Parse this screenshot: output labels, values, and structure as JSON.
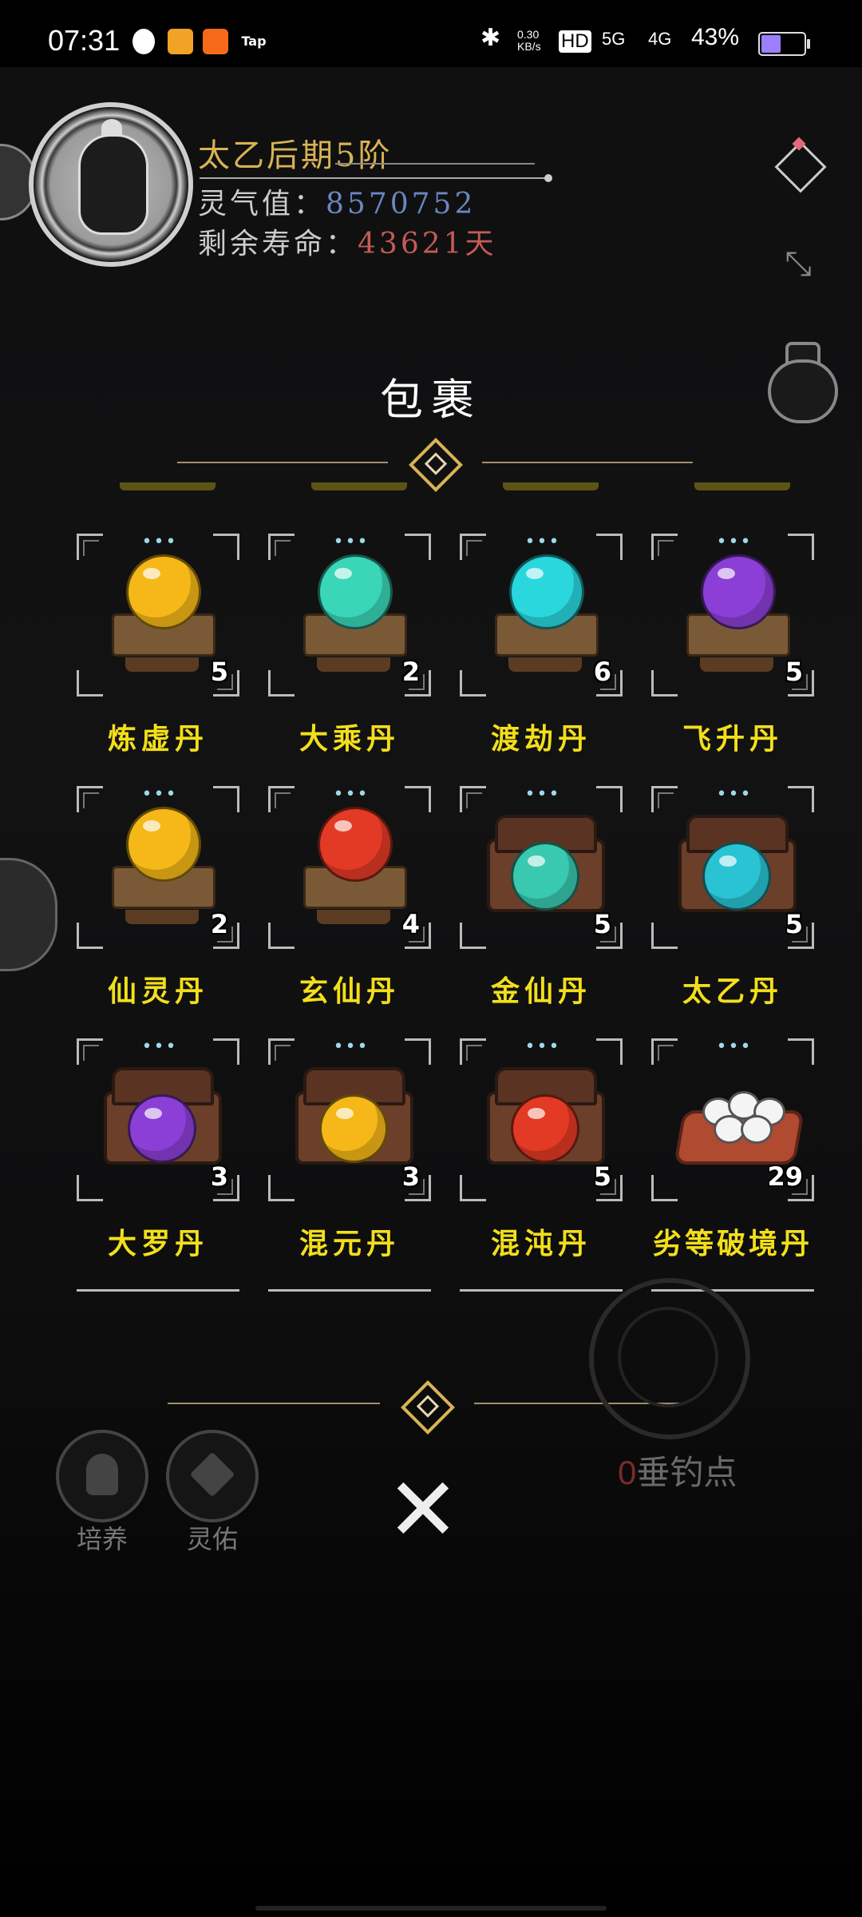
{
  "status_bar": {
    "time": "07:31",
    "speed": "0.30",
    "speed_unit": "KB/s",
    "net1": "HD",
    "net2": "5G",
    "net3": "4G",
    "battery": "43%"
  },
  "player": {
    "realm": "太乙后期5阶",
    "spirit_label": "灵气值：",
    "spirit_value": "8570752",
    "life_label": "剩余寿命：",
    "life_value": "43621",
    "life_unit": "天"
  },
  "bag": {
    "title": "包裹",
    "items": [
      {
        "name": "炼虚丹",
        "count": "5",
        "color": "#f5b818",
        "type": "stand"
      },
      {
        "name": "大乘丹",
        "count": "2",
        "color": "#39d6b8",
        "type": "stand"
      },
      {
        "name": "渡劫丹",
        "count": "6",
        "color": "#29d7dd",
        "type": "stand"
      },
      {
        "name": "飞升丹",
        "count": "5",
        "color": "#8b3fd6",
        "type": "stand"
      },
      {
        "name": "仙灵丹",
        "count": "2",
        "color": "#f5b818",
        "type": "stand"
      },
      {
        "name": "玄仙丹",
        "count": "4",
        "color": "#e23a24",
        "type": "stand"
      },
      {
        "name": "金仙丹",
        "count": "5",
        "color": "#39c9b0",
        "type": "chest"
      },
      {
        "name": "太乙丹",
        "count": "5",
        "color": "#29c3d3",
        "type": "chest"
      },
      {
        "name": "大罗丹",
        "count": "3",
        "color": "#8b3fd6",
        "type": "chest"
      },
      {
        "name": "混元丹",
        "count": "3",
        "color": "#f5b818",
        "type": "chest"
      },
      {
        "name": "混沌丹",
        "count": "5",
        "color": "#e23a24",
        "type": "chest"
      },
      {
        "name": "劣等破境丹",
        "count": "29",
        "color": "#f4f4f4",
        "type": "eggs"
      }
    ]
  },
  "fishing": {
    "count": "0",
    "label": "垂钓点"
  },
  "bottom_buttons": [
    {
      "label": "培养"
    },
    {
      "label": "灵佑"
    }
  ],
  "close_glyph": "✕"
}
